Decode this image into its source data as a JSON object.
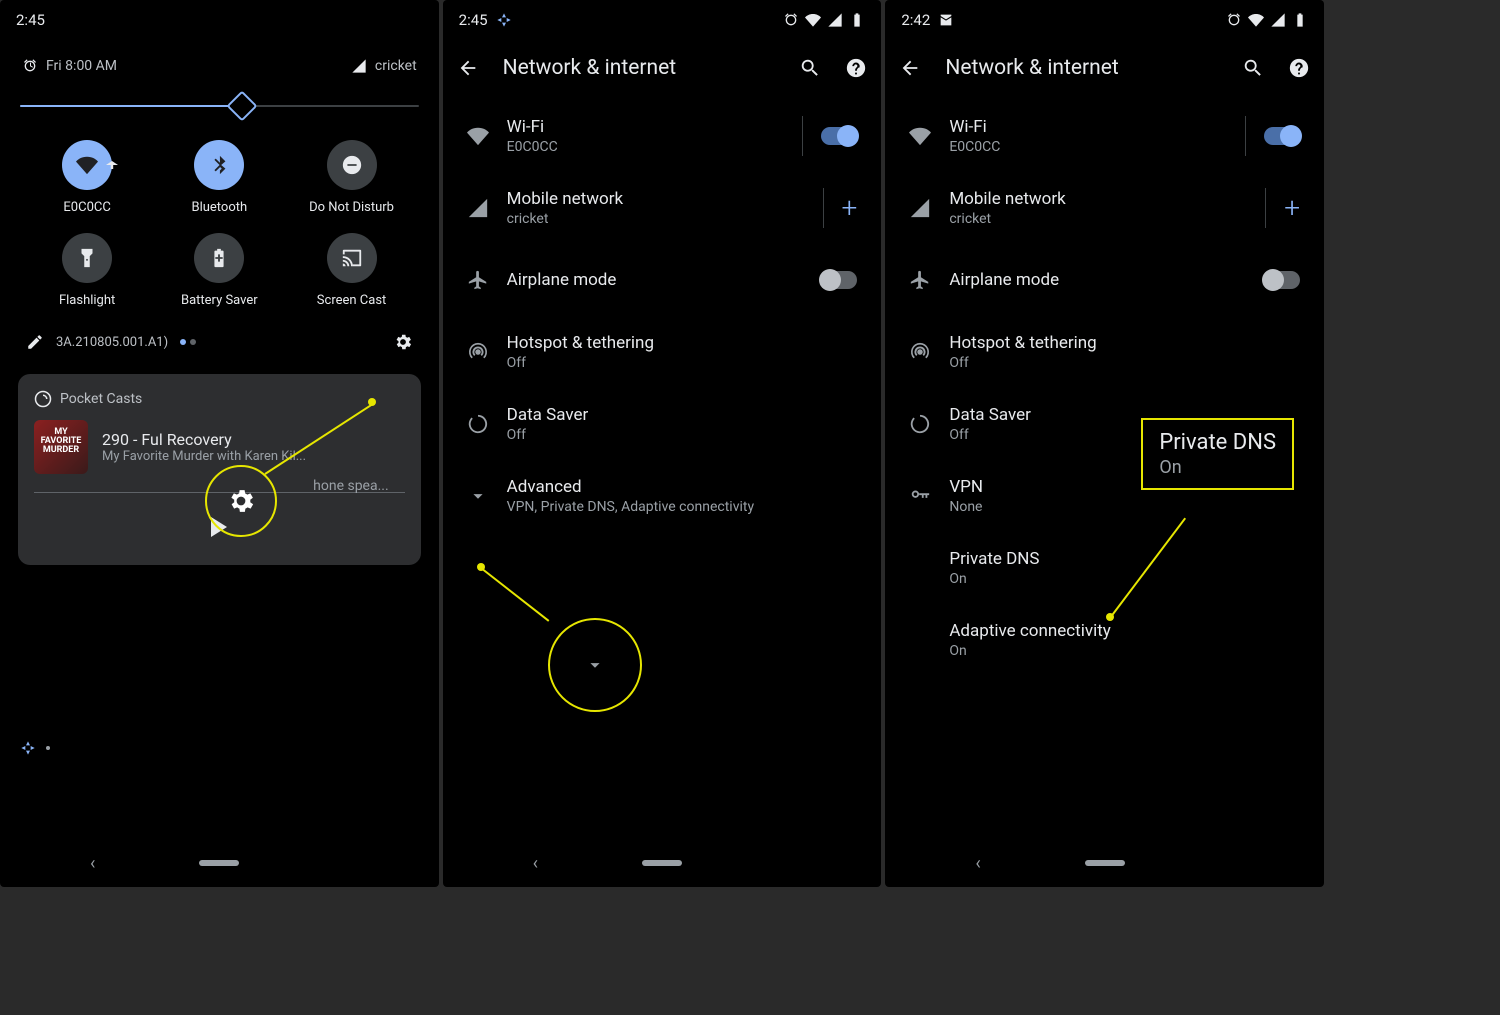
{
  "panel1": {
    "time": "2:45",
    "alarm": "Fri 8:00 AM",
    "carrier": "cricket",
    "tiles": {
      "wifi": "E0C0CC",
      "bluetooth": "Bluetooth",
      "dnd": "Do Not Disturb",
      "flashlight": "Flashlight",
      "battery": "Battery Saver",
      "cast": "Screen Cast"
    },
    "build": "3A.210805.001.A1)",
    "media": {
      "app": "Pocket Casts",
      "speaker": "hone spea...",
      "title": "290 - Ful          Recovery",
      "subtitle": "My Favorite Murder with Karen Kil..."
    }
  },
  "panel2": {
    "time": "2:45",
    "title": "Network & internet",
    "wifi": {
      "label": "Wi-Fi",
      "sub": "E0C0CC"
    },
    "mobile": {
      "label": "Mobile network",
      "sub": "cricket"
    },
    "airplane": {
      "label": "Airplane mode"
    },
    "hotspot": {
      "label": "Hotspot & tethering",
      "sub": "Off"
    },
    "datasaver": {
      "label": "Data Saver",
      "sub": "Off"
    },
    "advanced": {
      "label": "Advanced",
      "sub": "VPN, Private DNS, Adaptive connectivity"
    }
  },
  "panel3": {
    "time": "2:42",
    "title": "Network & internet",
    "wifi": {
      "label": "Wi-Fi",
      "sub": "E0C0CC"
    },
    "mobile": {
      "label": "Mobile network",
      "sub": "cricket"
    },
    "airplane": {
      "label": "Airplane mode"
    },
    "hotspot": {
      "label": "Hotspot & tethering",
      "sub": "Off"
    },
    "datasaver": {
      "label": "Data Saver",
      "sub": "Off"
    },
    "vpn": {
      "label": "VPN",
      "sub": "None"
    },
    "privatedns": {
      "label": "Private DNS",
      "sub": "On"
    },
    "adaptive": {
      "label": "Adaptive connectivity",
      "sub": "On"
    },
    "callout": {
      "title": "Private DNS",
      "sub": "On"
    }
  }
}
